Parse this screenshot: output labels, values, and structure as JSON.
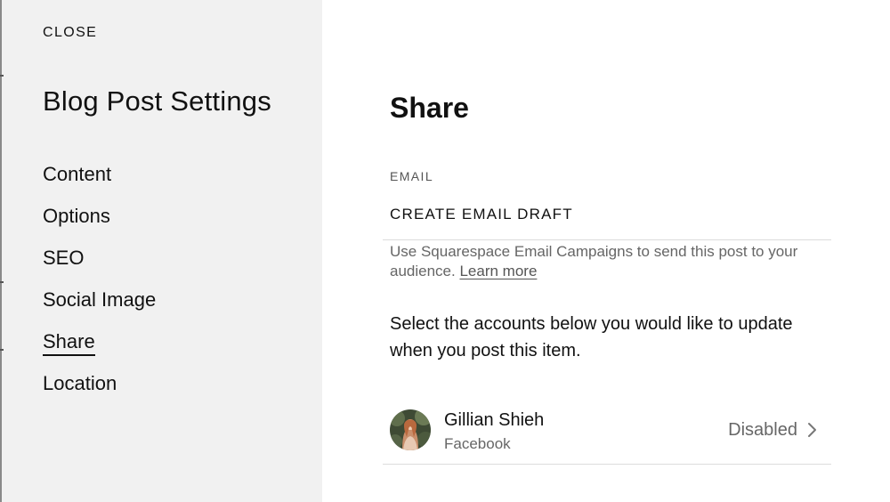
{
  "sidebar": {
    "close_label": "CLOSE",
    "title": "Blog Post Settings",
    "items": [
      {
        "label": "Content",
        "active": false
      },
      {
        "label": "Options",
        "active": false
      },
      {
        "label": "SEO",
        "active": false
      },
      {
        "label": "Social Image",
        "active": false
      },
      {
        "label": "Share",
        "active": true
      },
      {
        "label": "Location",
        "active": false
      }
    ]
  },
  "main": {
    "title": "Share",
    "email_section": {
      "label": "EMAIL",
      "action_label": "CREATE EMAIL DRAFT",
      "help_text": "Use Squarespace Email Campaigns to send this post to your audience.",
      "learn_more": "Learn more"
    },
    "accounts_prompt": "Select the accounts below you would like to update when you post this item.",
    "accounts": [
      {
        "name": "Gillian Shieh",
        "network": "Facebook",
        "status": "Disabled",
        "avatar_icon": "profile-photo"
      }
    ]
  },
  "colors": {
    "sidebar_bg": "#f1f1f1",
    "text_primary": "#111111",
    "text_secondary": "#666666",
    "divider": "#dcdcdc"
  }
}
